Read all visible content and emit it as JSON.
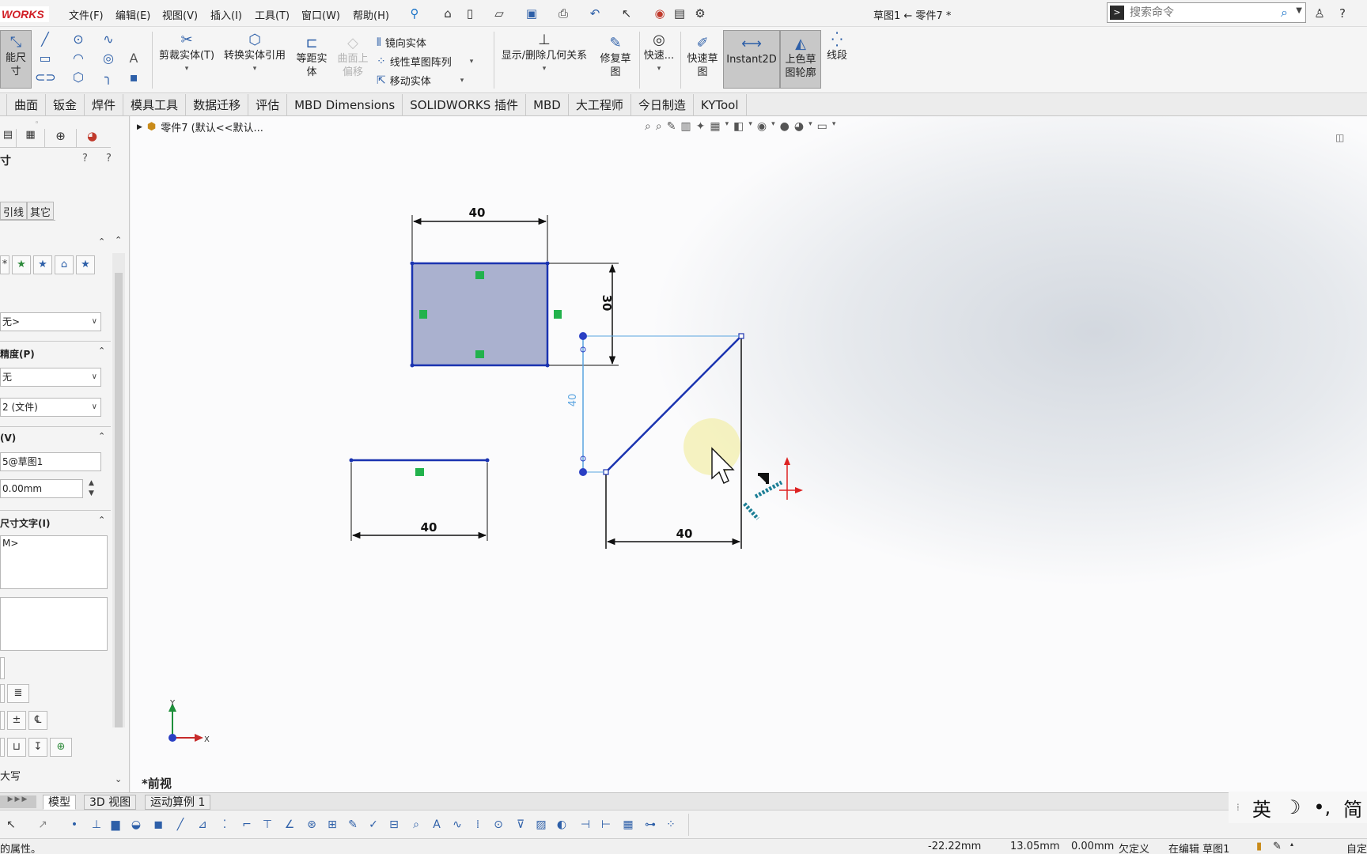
{
  "app": {
    "brand": "WORKS",
    "doc_title": "草图1 ← 零件7 *"
  },
  "menu": [
    "文件(F)",
    "编辑(E)",
    "视图(V)",
    "插入(I)",
    "工具(T)",
    "窗口(W)",
    "帮助(H)"
  ],
  "search": {
    "placeholder": "搜索命令"
  },
  "ribbon": {
    "smart_dim": "能尺寸",
    "trim": "剪裁实体(T)",
    "convert": "转换实体引用",
    "offset": "等距实\n体",
    "offset_surface": "曲面上\n偏移",
    "mirror": "镜向实体",
    "linear_pattern": "线性草图阵列",
    "move": "移动实体",
    "display_relations": "显示/删除几何关系",
    "repair": "修复草\n图",
    "quick_snaps": "快速...",
    "rapid_sketch": "快速草\n图",
    "instant2d": "Instant2D",
    "shaded_contours": "上色草\n图轮廓",
    "segment": "线段"
  },
  "cmd_tabs": [
    "曲面",
    "钣金",
    "焊件",
    "模具工具",
    "数据迁移",
    "评估",
    "MBD Dimensions",
    "SOLIDWORKS 插件",
    "MBD",
    "大工程师",
    "今日制造",
    "KYTool"
  ],
  "left_panel": {
    "title": "寸",
    "tab_leaders": "引线",
    "tab_other": "其它",
    "favorite_value": "无>",
    "tolerance_title": "精度(P)",
    "tolerance_value": "无",
    "precision_value": "2 (文件)",
    "primary_title": "(V)",
    "primary_name": "5@草图1",
    "primary_value": "0.00mm",
    "dim_text_title": "尺寸文字(I)",
    "dim_text_value": "M>",
    "caps_label": "大写"
  },
  "canvas": {
    "tree_label": "零件7 (默认<<默认...",
    "view_label": "*前视"
  },
  "sketch": {
    "dims": [
      "40",
      "30",
      "40",
      "40",
      "40"
    ],
    "axis_y": "Y",
    "axis_x": "X"
  },
  "bottom_tabs": [
    "模型",
    "3D 视图",
    "运动算例 1"
  ],
  "ime": [
    "英",
    "☽",
    "•,",
    "简"
  ],
  "status": {
    "hint": "的属性。",
    "x": "-22.22mm",
    "y": "13.05mm",
    "z": "0.00mm",
    "state": "欠定义",
    "editing": "在编辑 草图1",
    "custom": "自定"
  }
}
